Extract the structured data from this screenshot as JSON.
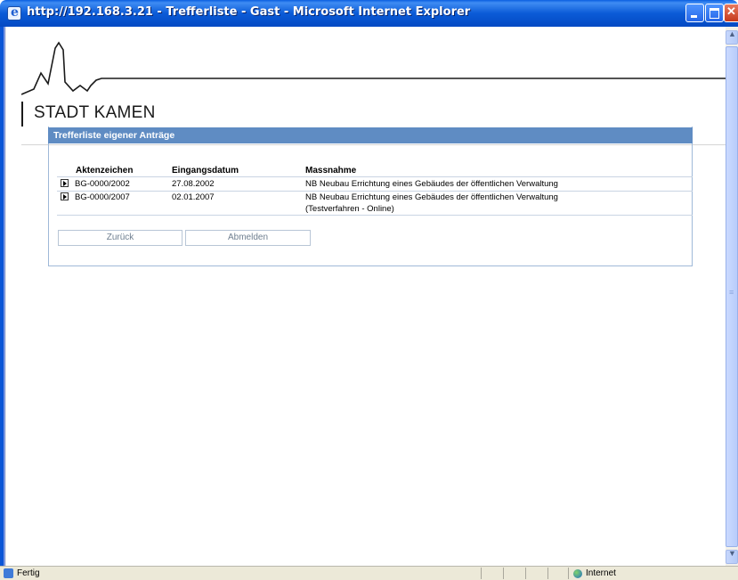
{
  "window": {
    "title": "http://192.168.3.21 - Trefferliste - Gast - Microsoft Internet Explorer"
  },
  "logo": {
    "text": "STADT KAMEN"
  },
  "panel": {
    "title": "Trefferliste eigener Anträge",
    "columns": [
      "Aktenzeichen",
      "Eingangsdatum",
      "Massnahme"
    ],
    "rows": [
      {
        "aktenzeichen": "BG-0000/2002",
        "eingangsdatum": "27.08.2002",
        "massnahme": "NB Neubau Errichtung eines Gebäudes der öffentlichen Verwaltung",
        "massnahme2": ""
      },
      {
        "aktenzeichen": "BG-0000/2007",
        "eingangsdatum": "02.01.2007",
        "massnahme": "NB Neubau Errichtung eines Gebäudes der öffentlichen Verwaltung",
        "massnahme2": "(Testverfahren - Online)"
      }
    ],
    "buttons": {
      "back": "Zurück",
      "logout": "Abmelden"
    }
  },
  "statusbar": {
    "status": "Fertig",
    "zone": "Internet"
  },
  "icons": {
    "titlebar": "ie-icon",
    "row": "expand-arrow-icon",
    "zone": "globe-icon"
  },
  "colors": {
    "titlebar": "#0b5bd7",
    "panel_header": "#5f8cc3",
    "close_button": "#c5391c"
  }
}
